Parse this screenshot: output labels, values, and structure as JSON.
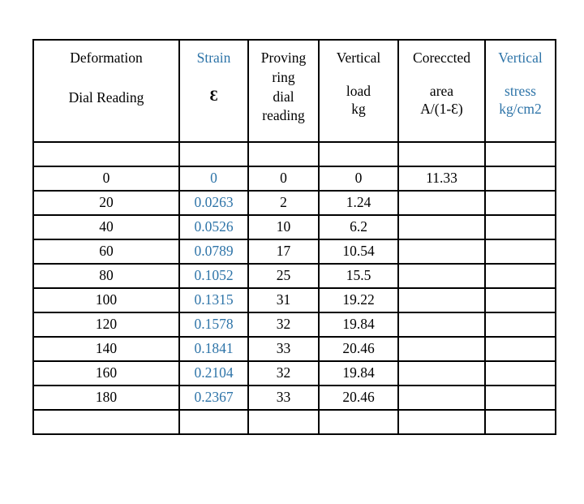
{
  "document": {
    "kind": "data-table",
    "accent_color": "#2E74A8",
    "text_color": "#000000",
    "border_color": "#000000",
    "background_color": "#FFFFFF"
  },
  "table": {
    "columns": [
      {
        "key": "deformation",
        "lines": [
          "Deformation",
          "Dial Reading"
        ],
        "color": "#000000",
        "align": "center"
      },
      {
        "key": "strain",
        "lines": [
          "Strain",
          "Ɛ"
        ],
        "color": "#2E74A8",
        "align": "center"
      },
      {
        "key": "proving",
        "lines": [
          "Proving",
          "ring",
          "dial",
          "reading"
        ],
        "color": "#000000",
        "align": "left"
      },
      {
        "key": "load",
        "lines": [
          "Vertical",
          "load",
          "kg"
        ],
        "color": "#000000",
        "align": "center"
      },
      {
        "key": "area",
        "lines": [
          "Coreccted",
          "area",
          "A/(1-Ɛ)"
        ],
        "color": "#000000",
        "align": "center"
      },
      {
        "key": "stress",
        "lines": [
          "Vertical",
          "stress",
          "kg/cm2"
        ],
        "color": "#2E74A8",
        "align": "center"
      }
    ],
    "rows": [
      {
        "deformation": "0",
        "strain": "0",
        "proving": "0",
        "load": "0",
        "area": "11.33",
        "stress": ""
      },
      {
        "deformation": "20",
        "strain": "0.0263",
        "proving": "2",
        "load": "1.24",
        "area": "",
        "stress": ""
      },
      {
        "deformation": "40",
        "strain": "0.0526",
        "proving": "10",
        "load": "6.2",
        "area": "",
        "stress": ""
      },
      {
        "deformation": "60",
        "strain": "0.0789",
        "proving": "17",
        "load": "10.54",
        "area": "",
        "stress": ""
      },
      {
        "deformation": "80",
        "strain": "0.1052",
        "proving": "25",
        "load": "15.5",
        "area": "",
        "stress": ""
      },
      {
        "deformation": "100",
        "strain": "0.1315",
        "proving": "31",
        "load": "19.22",
        "area": "",
        "stress": ""
      },
      {
        "deformation": "120",
        "strain": "0.1578",
        "proving": "32",
        "load": "19.84",
        "area": "",
        "stress": ""
      },
      {
        "deformation": "140",
        "strain": "0.1841",
        "proving": "33",
        "load": "20.46",
        "area": "",
        "stress": ""
      },
      {
        "deformation": "160",
        "strain": "0.2104",
        "proving": "32",
        "load": "19.84",
        "area": "",
        "stress": ""
      },
      {
        "deformation": "180",
        "strain": "0.2367",
        "proving": "33",
        "load": "20.46",
        "area": "",
        "stress": ""
      }
    ]
  },
  "chart_data": {
    "type": "table",
    "title": "",
    "columns": [
      "Deformation Dial Reading",
      "Strain Ɛ",
      "Proving ring dial reading",
      "Vertical load kg",
      "Coreccted area A/(1-Ɛ)",
      "Vertical stress kg/cm2"
    ],
    "series": [
      {
        "name": "Deformation Dial Reading",
        "values": [
          0,
          20,
          40,
          60,
          80,
          100,
          120,
          140,
          160,
          180
        ]
      },
      {
        "name": "Strain Ɛ",
        "values": [
          0,
          0.0263,
          0.0526,
          0.0789,
          0.1052,
          0.1315,
          0.1578,
          0.1841,
          0.2104,
          0.2367
        ]
      },
      {
        "name": "Proving ring dial reading",
        "values": [
          0,
          2,
          10,
          17,
          25,
          31,
          32,
          33,
          32,
          33
        ]
      },
      {
        "name": "Vertical load kg",
        "values": [
          0,
          1.24,
          6.2,
          10.54,
          15.5,
          19.22,
          19.84,
          20.46,
          19.84,
          20.46
        ]
      },
      {
        "name": "Coreccted area A/(1-Ɛ)",
        "values": [
          11.33,
          null,
          null,
          null,
          null,
          null,
          null,
          null,
          null,
          null
        ]
      },
      {
        "name": "Vertical stress kg/cm2",
        "values": [
          null,
          null,
          null,
          null,
          null,
          null,
          null,
          null,
          null,
          null
        ]
      }
    ]
  }
}
